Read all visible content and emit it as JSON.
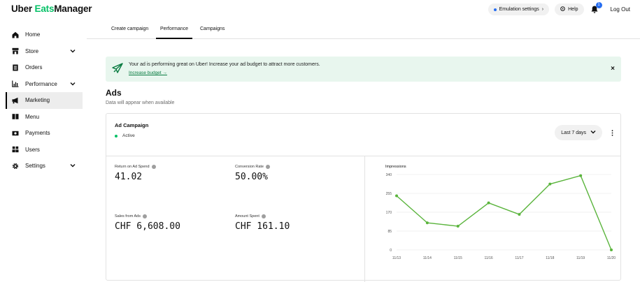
{
  "header": {
    "logo_part1": "Uber",
    "logo_part2": "Eats",
    "logo_part3": "Manager",
    "emulation_label": "Emulation settings",
    "help_label": "Help",
    "notification_count": "1",
    "logout_label": "Log Out"
  },
  "sidebar": {
    "items": [
      {
        "label": "Home",
        "icon": "home-icon"
      },
      {
        "label": "Store",
        "icon": "store-icon",
        "has_chevron": true
      },
      {
        "label": "Orders",
        "icon": "orders-icon"
      },
      {
        "label": "Performance",
        "icon": "performance-icon",
        "has_chevron": true
      },
      {
        "label": "Marketing",
        "icon": "megaphone-icon",
        "active": true
      },
      {
        "label": "Menu",
        "icon": "menu-book-icon"
      },
      {
        "label": "Payments",
        "icon": "payments-icon"
      },
      {
        "label": "Users",
        "icon": "users-icon"
      },
      {
        "label": "Settings",
        "icon": "gear-icon",
        "has_chevron": true
      }
    ]
  },
  "tabs": [
    {
      "label": "Create campaign"
    },
    {
      "label": "Performance",
      "active": true
    },
    {
      "label": "Campaigns"
    }
  ],
  "banner": {
    "message": "Your ad is performing great on Uber! Increase your ad budget to attract more customers.",
    "link": "Increase budget →",
    "close": "×"
  },
  "ads": {
    "title": "Ads",
    "subtitle": "Data will appear when available"
  },
  "campaign": {
    "title": "Ad Campaign",
    "status": "Active",
    "range_label": "Last 7 days",
    "metrics": {
      "roas": {
        "label": "Return on Ad Spend",
        "value": "41.02"
      },
      "conversion": {
        "label": "Conversion Rate",
        "value": "50.00%"
      },
      "sales": {
        "label": "Sales from Ads",
        "value": "CHF 6,608.00"
      },
      "spent": {
        "label": "Amount Spent",
        "value": "CHF 161.10"
      }
    }
  },
  "colors": {
    "accent_green": "#06c167",
    "line_green": "#5ab43c",
    "banner_bg": "#e8f6ee",
    "link_green": "#067a3f",
    "badge_blue": "#276ef1"
  },
  "chart_data": {
    "type": "line",
    "title": "Impressions",
    "x": [
      "11/13",
      "11/14",
      "11/15",
      "11/16",
      "11/17",
      "11/18",
      "11/19",
      "11/20"
    ],
    "series": [
      {
        "values": [
          244,
          122,
          107,
          212,
          160,
          297,
          335,
          0
        ]
      }
    ],
    "yticks": [
      0,
      85,
      170,
      255,
      340
    ],
    "ylim": [
      0,
      340
    ],
    "grid": true
  }
}
